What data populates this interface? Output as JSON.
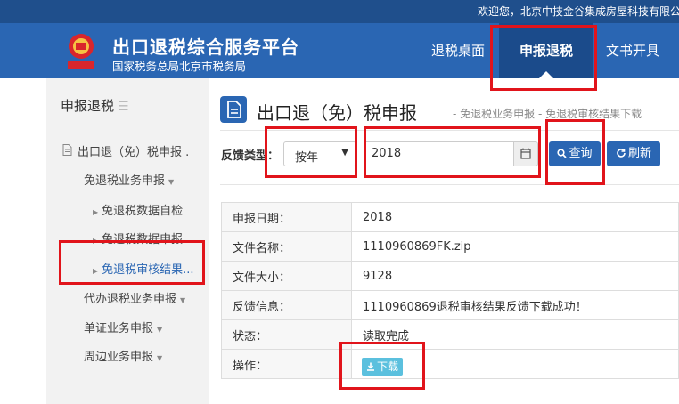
{
  "topbar": {
    "welcome": "欢迎您，北京中技金谷集成房屋科技有限公司"
  },
  "header": {
    "title": "出口退税综合服务平台",
    "subtitle": "国家税务总局北京市税务局",
    "emblem_text": "中国税务",
    "nav": {
      "tax_desk": "退税桌面",
      "declare": "申报退税",
      "docs": "文书开具"
    }
  },
  "sidebar": {
    "title": "申报退税",
    "export_refund": "出口退（免）税申报 .",
    "refund_business": "免退税业务申报",
    "data_check": "免退税数据自检",
    "data_declare": "免退税数据申报",
    "audit_result": "免退税审核结果...",
    "agent_business": "代办退税业务申报",
    "certificate_business": "单证业务申报",
    "peripheral_business": "周边业务申报"
  },
  "main": {
    "title": "出口退（免）税申报",
    "crumb_1": "- 免退税业务申报",
    "crumb_2": "- 免退税审核结果下载",
    "filter_label": "反馈类型：",
    "year_option": "按年",
    "date_value": "2018",
    "query_label": "查询",
    "refresh_label": "刷新"
  },
  "details": {
    "date_key": "申报日期：",
    "date_val": "2018",
    "file_key": "文件名称：",
    "file_val": "1110960869FK.zip",
    "size_key": "文件大小：",
    "size_val": "9128",
    "feedback_key": "反馈信息：",
    "feedback_val": "1110960869退税审核结果反馈下载成功！",
    "status_key": "状态：",
    "status_val": "读取完成",
    "action_key": "操作：",
    "download_label": "下载"
  },
  "colors": {
    "primary": "#2a66b3",
    "topbar": "#1f4f8c",
    "highlight": "#e1141b",
    "download": "#5bc0de"
  },
  "icons": [
    "tax-emblem-icon",
    "menu-lines-icon",
    "document-icon",
    "chevron-down-icon",
    "triangle-right-icon",
    "calendar-icon",
    "search-icon",
    "refresh-icon",
    "download-icon"
  ]
}
